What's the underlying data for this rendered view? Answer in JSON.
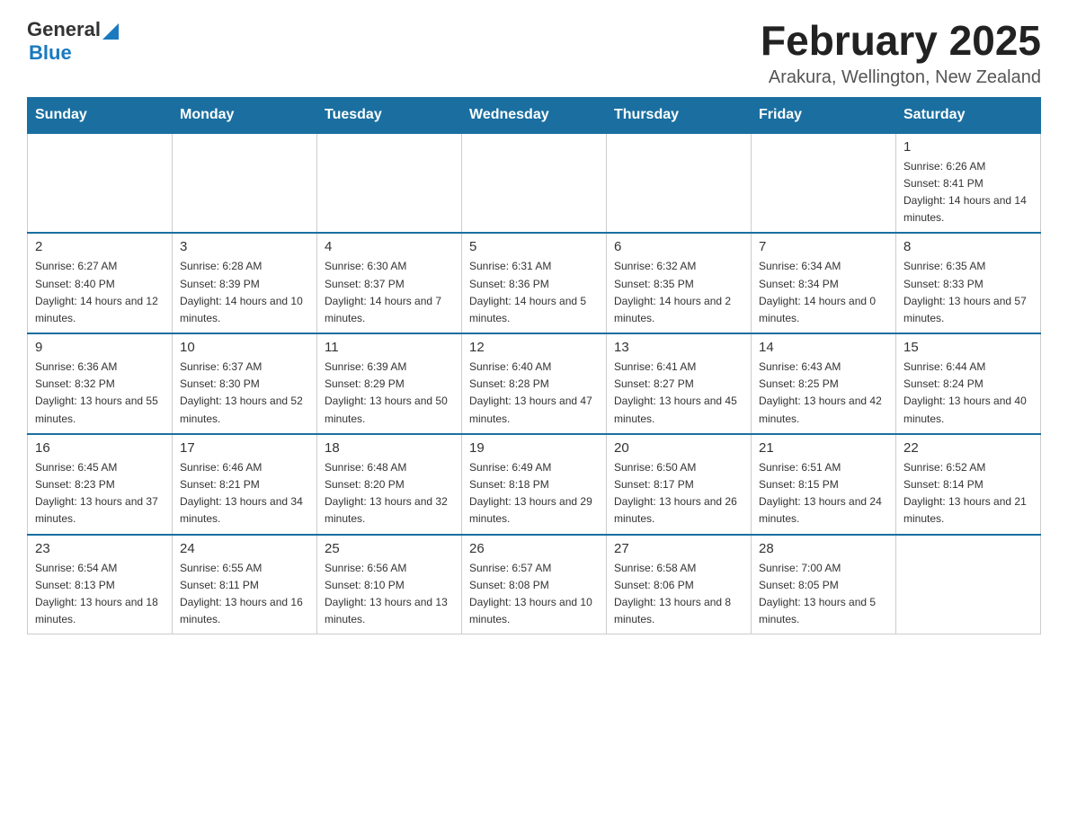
{
  "logo": {
    "general": "General",
    "blue": "Blue"
  },
  "header": {
    "title": "February 2025",
    "subtitle": "Arakura, Wellington, New Zealand"
  },
  "weekdays": [
    "Sunday",
    "Monday",
    "Tuesday",
    "Wednesday",
    "Thursday",
    "Friday",
    "Saturday"
  ],
  "weeks": [
    [
      {
        "day": "",
        "info": ""
      },
      {
        "day": "",
        "info": ""
      },
      {
        "day": "",
        "info": ""
      },
      {
        "day": "",
        "info": ""
      },
      {
        "day": "",
        "info": ""
      },
      {
        "day": "",
        "info": ""
      },
      {
        "day": "1",
        "info": "Sunrise: 6:26 AM\nSunset: 8:41 PM\nDaylight: 14 hours and 14 minutes."
      }
    ],
    [
      {
        "day": "2",
        "info": "Sunrise: 6:27 AM\nSunset: 8:40 PM\nDaylight: 14 hours and 12 minutes."
      },
      {
        "day": "3",
        "info": "Sunrise: 6:28 AM\nSunset: 8:39 PM\nDaylight: 14 hours and 10 minutes."
      },
      {
        "day": "4",
        "info": "Sunrise: 6:30 AM\nSunset: 8:37 PM\nDaylight: 14 hours and 7 minutes."
      },
      {
        "day": "5",
        "info": "Sunrise: 6:31 AM\nSunset: 8:36 PM\nDaylight: 14 hours and 5 minutes."
      },
      {
        "day": "6",
        "info": "Sunrise: 6:32 AM\nSunset: 8:35 PM\nDaylight: 14 hours and 2 minutes."
      },
      {
        "day": "7",
        "info": "Sunrise: 6:34 AM\nSunset: 8:34 PM\nDaylight: 14 hours and 0 minutes."
      },
      {
        "day": "8",
        "info": "Sunrise: 6:35 AM\nSunset: 8:33 PM\nDaylight: 13 hours and 57 minutes."
      }
    ],
    [
      {
        "day": "9",
        "info": "Sunrise: 6:36 AM\nSunset: 8:32 PM\nDaylight: 13 hours and 55 minutes."
      },
      {
        "day": "10",
        "info": "Sunrise: 6:37 AM\nSunset: 8:30 PM\nDaylight: 13 hours and 52 minutes."
      },
      {
        "day": "11",
        "info": "Sunrise: 6:39 AM\nSunset: 8:29 PM\nDaylight: 13 hours and 50 minutes."
      },
      {
        "day": "12",
        "info": "Sunrise: 6:40 AM\nSunset: 8:28 PM\nDaylight: 13 hours and 47 minutes."
      },
      {
        "day": "13",
        "info": "Sunrise: 6:41 AM\nSunset: 8:27 PM\nDaylight: 13 hours and 45 minutes."
      },
      {
        "day": "14",
        "info": "Sunrise: 6:43 AM\nSunset: 8:25 PM\nDaylight: 13 hours and 42 minutes."
      },
      {
        "day": "15",
        "info": "Sunrise: 6:44 AM\nSunset: 8:24 PM\nDaylight: 13 hours and 40 minutes."
      }
    ],
    [
      {
        "day": "16",
        "info": "Sunrise: 6:45 AM\nSunset: 8:23 PM\nDaylight: 13 hours and 37 minutes."
      },
      {
        "day": "17",
        "info": "Sunrise: 6:46 AM\nSunset: 8:21 PM\nDaylight: 13 hours and 34 minutes."
      },
      {
        "day": "18",
        "info": "Sunrise: 6:48 AM\nSunset: 8:20 PM\nDaylight: 13 hours and 32 minutes."
      },
      {
        "day": "19",
        "info": "Sunrise: 6:49 AM\nSunset: 8:18 PM\nDaylight: 13 hours and 29 minutes."
      },
      {
        "day": "20",
        "info": "Sunrise: 6:50 AM\nSunset: 8:17 PM\nDaylight: 13 hours and 26 minutes."
      },
      {
        "day": "21",
        "info": "Sunrise: 6:51 AM\nSunset: 8:15 PM\nDaylight: 13 hours and 24 minutes."
      },
      {
        "day": "22",
        "info": "Sunrise: 6:52 AM\nSunset: 8:14 PM\nDaylight: 13 hours and 21 minutes."
      }
    ],
    [
      {
        "day": "23",
        "info": "Sunrise: 6:54 AM\nSunset: 8:13 PM\nDaylight: 13 hours and 18 minutes."
      },
      {
        "day": "24",
        "info": "Sunrise: 6:55 AM\nSunset: 8:11 PM\nDaylight: 13 hours and 16 minutes."
      },
      {
        "day": "25",
        "info": "Sunrise: 6:56 AM\nSunset: 8:10 PM\nDaylight: 13 hours and 13 minutes."
      },
      {
        "day": "26",
        "info": "Sunrise: 6:57 AM\nSunset: 8:08 PM\nDaylight: 13 hours and 10 minutes."
      },
      {
        "day": "27",
        "info": "Sunrise: 6:58 AM\nSunset: 8:06 PM\nDaylight: 13 hours and 8 minutes."
      },
      {
        "day": "28",
        "info": "Sunrise: 7:00 AM\nSunset: 8:05 PM\nDaylight: 13 hours and 5 minutes."
      },
      {
        "day": "",
        "info": ""
      }
    ]
  ]
}
